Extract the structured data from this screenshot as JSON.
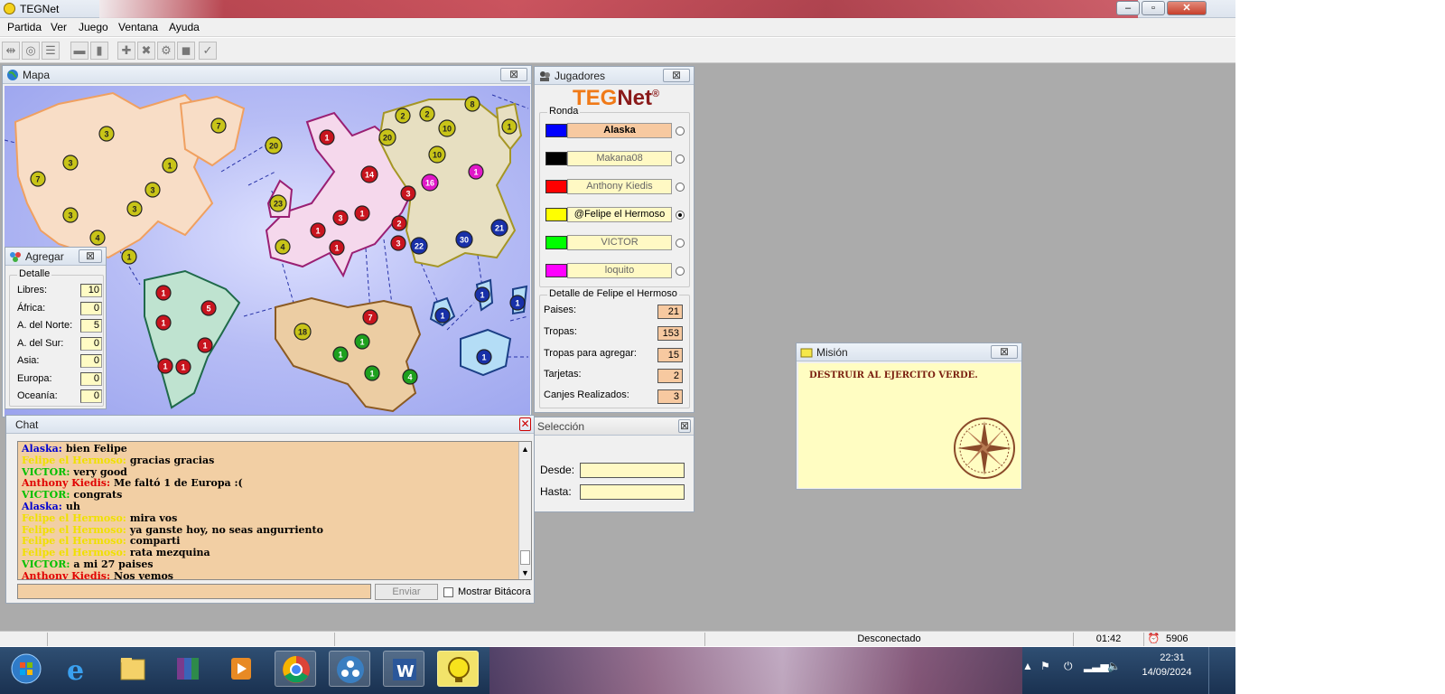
{
  "app": {
    "title": "TEGNet"
  },
  "menu": [
    "Partida",
    "Ver",
    "Juego",
    "Ventana",
    "Ayuda"
  ],
  "toolbar_icons": [
    "connect-icon",
    "disconnect-icon",
    "list-icon",
    "card-icon",
    "card2-icon",
    "add-icon",
    "attack-icon",
    "regroup-icon",
    "get-card-icon",
    "end-turn-icon"
  ],
  "map_window": {
    "title": "Mapa",
    "badge_colors": {
      "yellow": "#c8c418",
      "red": "#c8141e",
      "blue": "#1830a8",
      "green": "#1ea01e",
      "magenta": "#e018c8"
    },
    "continent_colors": {
      "north_america": "#f8ddc6",
      "south_america": "#bfe3d0",
      "europe": "#f5d8ec",
      "asia": "#e7dfc1",
      "africa": "#eccda3",
      "oceania": "#b4ddf6"
    },
    "armies": [
      {
        "v": "3",
        "c": "yellow"
      },
      {
        "v": "7",
        "c": "yellow"
      },
      {
        "v": "3",
        "c": "yellow"
      },
      {
        "v": "7",
        "c": "yellow"
      },
      {
        "v": "1",
        "c": "yellow"
      },
      {
        "v": "3",
        "c": "yellow"
      },
      {
        "v": "3",
        "c": "yellow"
      },
      {
        "v": "3",
        "c": "yellow"
      },
      {
        "v": "4",
        "c": "yellow"
      },
      {
        "v": "1",
        "c": "yellow"
      },
      {
        "v": "20",
        "c": "yellow"
      },
      {
        "v": "23",
        "c": "yellow"
      },
      {
        "v": "4",
        "c": "yellow"
      },
      {
        "v": "1",
        "c": "red"
      },
      {
        "v": "14",
        "c": "red"
      },
      {
        "v": "3",
        "c": "red"
      },
      {
        "v": "1",
        "c": "red"
      },
      {
        "v": "3",
        "c": "red"
      },
      {
        "v": "1",
        "c": "red"
      },
      {
        "v": "1",
        "c": "red"
      },
      {
        "v": "2",
        "c": "yellow"
      },
      {
        "v": "2",
        "c": "yellow"
      },
      {
        "v": "8",
        "c": "yellow"
      },
      {
        "v": "1",
        "c": "yellow"
      },
      {
        "v": "20",
        "c": "yellow"
      },
      {
        "v": "10",
        "c": "yellow"
      },
      {
        "v": "10",
        "c": "yellow"
      },
      {
        "v": "1",
        "c": "magenta"
      },
      {
        "v": "16",
        "c": "magenta"
      },
      {
        "v": "2",
        "c": "red"
      },
      {
        "v": "3",
        "c": "red"
      },
      {
        "v": "22",
        "c": "blue"
      },
      {
        "v": "30",
        "c": "blue"
      },
      {
        "v": "21",
        "c": "blue"
      },
      {
        "v": "1",
        "c": "red"
      },
      {
        "v": "5",
        "c": "red"
      },
      {
        "v": "1",
        "c": "red"
      },
      {
        "v": "1",
        "c": "red"
      },
      {
        "v": "1",
        "c": "red"
      },
      {
        "v": "1",
        "c": "red"
      },
      {
        "v": "18",
        "c": "yellow"
      },
      {
        "v": "7",
        "c": "red"
      },
      {
        "v": "1",
        "c": "green"
      },
      {
        "v": "1",
        "c": "green"
      },
      {
        "v": "1",
        "c": "green"
      },
      {
        "v": "4",
        "c": "green"
      },
      {
        "v": "1",
        "c": "blue"
      },
      {
        "v": "1",
        "c": "blue"
      },
      {
        "v": "1",
        "c": "blue"
      },
      {
        "v": "1",
        "c": "blue"
      }
    ]
  },
  "agregar": {
    "title": "Agregar",
    "group": "Detalle",
    "rows": [
      {
        "label": "Libres:",
        "value": "10"
      },
      {
        "label": "África:",
        "value": "0"
      },
      {
        "label": "A. del Norte:",
        "value": "5"
      },
      {
        "label": "A. del Sur:",
        "value": "0"
      },
      {
        "label": "Asia:",
        "value": "0"
      },
      {
        "label": "Europa:",
        "value": "0"
      },
      {
        "label": "Oceanía:",
        "value": "0"
      }
    ]
  },
  "players_window": {
    "title": "Jugadores",
    "logo": {
      "teg": "TEG",
      "net": "Net",
      "mark": "®"
    },
    "group": "Ronda",
    "players": [
      {
        "name": "Alaska",
        "color": "#0000ff",
        "active": false,
        "highlight": true
      },
      {
        "name": "Makana08",
        "color": "#000000",
        "active": false,
        "highlight": false
      },
      {
        "name": "Anthony Kiedis",
        "color": "#ff0000",
        "active": false,
        "highlight": false
      },
      {
        "name": "@Felipe el Hermoso",
        "color": "#ffff00",
        "active": true,
        "highlight": false
      },
      {
        "name": "VICTOR",
        "color": "#00ff00",
        "active": false,
        "highlight": false
      },
      {
        "name": "loquito",
        "color": "#ff00ff",
        "active": false,
        "highlight": false
      }
    ],
    "detail_group": "Detalle de Felipe el Hermoso",
    "stats": [
      {
        "label": "Paises:",
        "value": "21"
      },
      {
        "label": "Tropas:",
        "value": "153"
      },
      {
        "label": "Tropas para agregar:",
        "value": "15"
      },
      {
        "label": "Tarjetas:",
        "value": "2"
      },
      {
        "label": "Canjes Realizados:",
        "value": "3"
      }
    ]
  },
  "chat": {
    "title": "Chat",
    "lines": [
      {
        "user": "Alaska:",
        "color": "#0000d0",
        "text": "bien Felipe"
      },
      {
        "user": "Felipe el Hermoso:",
        "color": "#f0e000",
        "text": "gracias gracias"
      },
      {
        "user": "VICTOR:",
        "color": "#00c000",
        "text": "very good"
      },
      {
        "user": "Anthony Kiedis:",
        "color": "#e00000",
        "text": "Me faltó 1 de Europa :("
      },
      {
        "user": "VICTOR:",
        "color": "#00c000",
        "text": "congrats"
      },
      {
        "user": "Alaska:",
        "color": "#0000d0",
        "text": "uh"
      },
      {
        "user": "Felipe el Hermoso:",
        "color": "#f0e000",
        "text": "mira vos"
      },
      {
        "user": "Felipe el Hermoso:",
        "color": "#f0e000",
        "text": "ya ganste hoy, no seas angurriento"
      },
      {
        "user": "Felipe el Hermoso:",
        "color": "#f0e000",
        "text": "comparti"
      },
      {
        "user": "Felipe el Hermoso:",
        "color": "#f0e000",
        "text": "rata mezquina"
      },
      {
        "user": "VICTOR:",
        "color": "#00c000",
        "text": "a mi 27 paises"
      },
      {
        "user": "Anthony Kiedis:",
        "color": "#e00000",
        "text": "Nos vemos"
      }
    ],
    "input_value": "",
    "send_label": "Enviar",
    "log_label": "Mostrar Bitácora"
  },
  "seleccion": {
    "title": "Selección",
    "from_label": "Desde:",
    "to_label": "Hasta:",
    "from_value": "",
    "to_value": ""
  },
  "mission": {
    "title": "Misión",
    "text": "DESTRUIR AL EJERCITO VERDE."
  },
  "status": {
    "connection": "Desconectado",
    "time": "01:42",
    "counter": "5906"
  },
  "taskbar": {
    "apps": [
      "start-orb-icon",
      "internet-explorer-icon",
      "file-explorer-icon",
      "winrar-icon",
      "media-player-icon",
      "chrome-icon",
      "app-circle-icon",
      "word-icon",
      "tegnet-icon"
    ],
    "time": "22:31",
    "date": "14/09/2024"
  }
}
